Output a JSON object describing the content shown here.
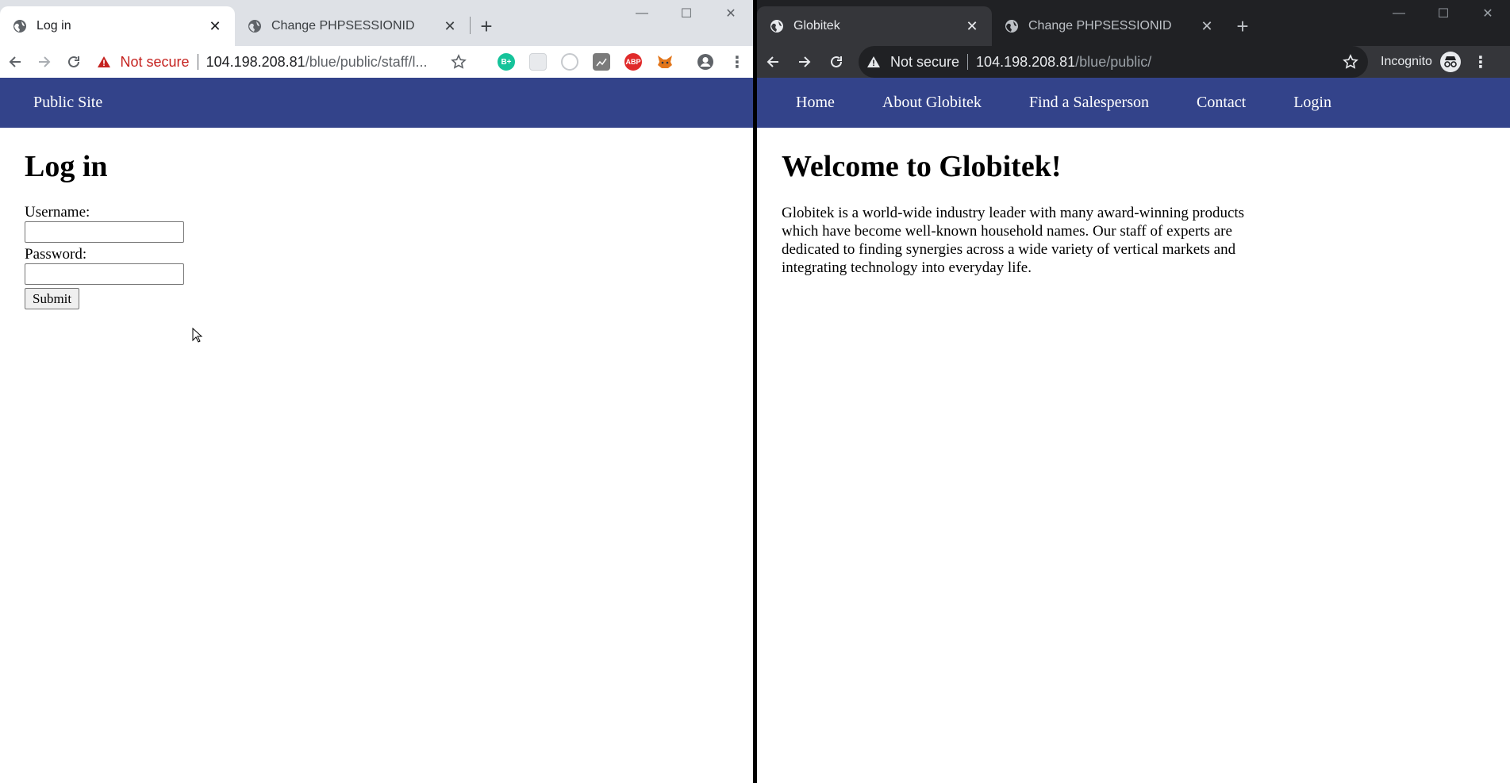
{
  "left_window": {
    "tabs": [
      {
        "title": "Log in",
        "active": true
      },
      {
        "title": "Change PHPSESSIONID",
        "active": false
      }
    ],
    "address": {
      "security": "Not secure",
      "host": "104.198.208.81",
      "path": "/blue/public/staff/l..."
    },
    "extensions": [
      "grammarly-icon",
      "blank-extension-icon",
      "circle-extension-icon",
      "chart-extension-icon",
      "adblock-icon",
      "metamask-icon"
    ],
    "adblock_label": "ABP",
    "grammarly_label": "B+",
    "site_nav": [
      "Public Site"
    ],
    "page": {
      "heading": "Log in",
      "username_label": "Username:",
      "password_label": "Password:",
      "submit_label": "Submit",
      "username_value": "",
      "password_value": ""
    }
  },
  "right_window": {
    "tabs": [
      {
        "title": "Globitek",
        "active": true
      },
      {
        "title": "Change PHPSESSIONID",
        "active": false
      }
    ],
    "address": {
      "security": "Not secure",
      "host": "104.198.208.81",
      "path": "/blue/public/"
    },
    "incognito_label": "Incognito",
    "site_nav": [
      "Home",
      "About Globitek",
      "Find a Salesperson",
      "Contact",
      "Login"
    ],
    "page": {
      "heading": "Welcome to Globitek!",
      "body": "Globitek is a world-wide industry leader with many award-winning products which have become well-known household names. Our staff of experts are dedicated to finding synergies across a wide variety of vertical markets and integrating technology into everyday life."
    }
  },
  "colors": {
    "site_nav_bg": "#33438a",
    "not_secure_red": "#c5221f",
    "incognito_dark": "#202124"
  }
}
